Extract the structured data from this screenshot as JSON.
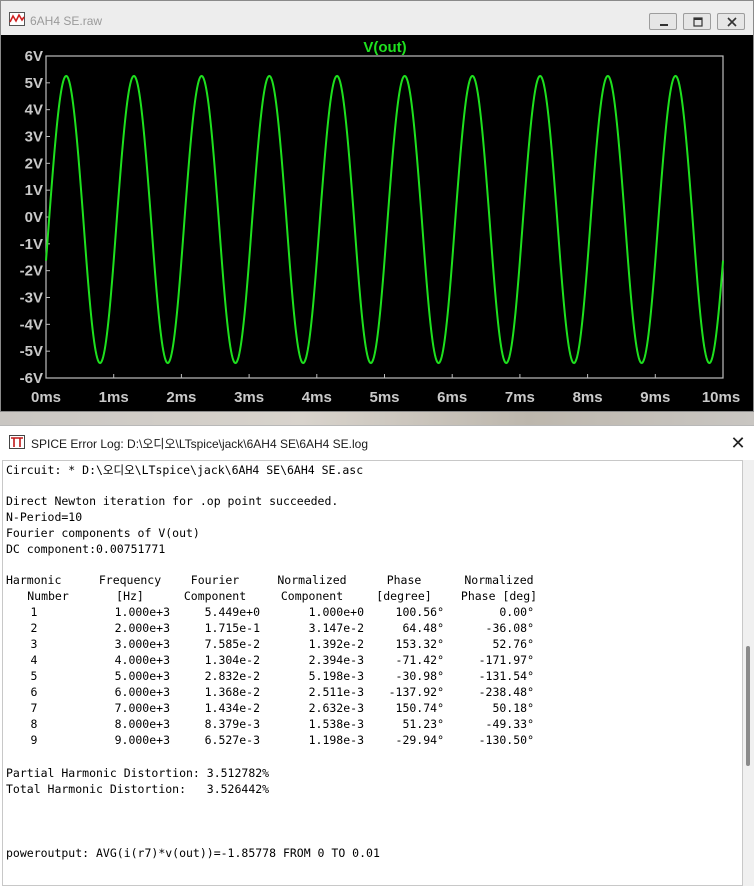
{
  "wave_window": {
    "title": "6AH4 SE.raw",
    "trace_name": "V(out)",
    "trace_color": "#1ee01e",
    "background_color": "#000000"
  },
  "chart_data": {
    "type": "line",
    "title": "V(out)",
    "xlabel": "",
    "ylabel": "",
    "x_tick_labels": [
      "0ms",
      "1ms",
      "2ms",
      "3ms",
      "4ms",
      "5ms",
      "6ms",
      "7ms",
      "8ms",
      "9ms",
      "10ms"
    ],
    "y_tick_labels": [
      "6V",
      "5V",
      "4V",
      "3V",
      "2V",
      "1V",
      "0V",
      "-1V",
      "-2V",
      "-3V",
      "-4V",
      "-5V",
      "-6V"
    ],
    "xlim": [
      0,
      10
    ],
    "ylim": [
      -6,
      6
    ],
    "grid": false,
    "series": [
      {
        "name": "V(out)",
        "frequency_hz": 1000,
        "amplitude": 5.449,
        "offset": 0.0075,
        "phase_deg": 100.56,
        "x": [
          0,
          0.25,
          0.5,
          0.75,
          1.0,
          1.25,
          1.5,
          1.75,
          2.0,
          2.25,
          2.5,
          2.75,
          3.0,
          3.25,
          3.5,
          3.75,
          4.0,
          4.25,
          4.5,
          4.75,
          5.0,
          5.25,
          5.5,
          5.75,
          6.0,
          6.25,
          6.5,
          6.75,
          7.0,
          7.25,
          7.5,
          7.75,
          8.0,
          8.25,
          8.5,
          8.75,
          9.0,
          9.25,
          9.5,
          9.75,
          10.0
        ],
        "y": [
          -1.0,
          5.2,
          1.0,
          -5.4,
          -1.0,
          5.2,
          1.0,
          -5.4,
          -1.0,
          5.2,
          1.0,
          -5.4,
          -1.0,
          5.2,
          1.0,
          -5.4,
          -1.0,
          5.2,
          1.0,
          -5.4,
          -1.0,
          5.2,
          1.0,
          -5.4,
          -1.0,
          5.2,
          1.0,
          -5.4,
          -1.0,
          5.2,
          1.0,
          -5.4,
          -1.0,
          5.2,
          1.0,
          -5.4,
          -1.0,
          5.2,
          1.0,
          -5.4,
          -1.0
        ]
      }
    ]
  },
  "log_window": {
    "title": "SPICE Error Log: D:\\오디오\\LTspice\\jack\\6AH4 SE\\6AH4 SE.log",
    "close_glyph": "✕",
    "lines": {
      "circuit": "Circuit: * D:\\오디오\\LTspice\\jack\\6AH4 SE\\6AH4 SE.asc",
      "newton": "Direct Newton iteration for .op point succeeded.",
      "nperiod": "N-Period=10",
      "fourier": "Fourier components of V(out)",
      "dc": "DC component:0.00751771",
      "partial": "Partial Harmonic Distortion: 3.512782%",
      "total": "Total Harmonic Distortion:   3.526442%",
      "power": "poweroutput: AVG(i(r7)*v(out))=-1.85778 FROM 0 TO 0.01"
    },
    "table": {
      "header1": [
        "Harmonic",
        "Frequency",
        "Fourier",
        "Normalized",
        "Phase",
        "Normalized"
      ],
      "header2": [
        "Number",
        "[Hz]",
        "Component",
        "Component",
        "[degree]",
        "Phase [deg]"
      ],
      "rows": [
        [
          "1",
          "1.000e+3",
          "5.449e+0",
          "1.000e+0",
          "100.56°",
          "0.00°"
        ],
        [
          "2",
          "2.000e+3",
          "1.715e-1",
          "3.147e-2",
          "64.48°",
          "-36.08°"
        ],
        [
          "3",
          "3.000e+3",
          "7.585e-2",
          "1.392e-2",
          "153.32°",
          "52.76°"
        ],
        [
          "4",
          "4.000e+3",
          "1.304e-2",
          "2.394e-3",
          "-71.42°",
          "-171.97°"
        ],
        [
          "5",
          "5.000e+3",
          "2.832e-2",
          "5.198e-3",
          "-30.98°",
          "-131.54°"
        ],
        [
          "6",
          "6.000e+3",
          "1.368e-2",
          "2.511e-3",
          "-137.92°",
          "-238.48°"
        ],
        [
          "7",
          "7.000e+3",
          "1.434e-2",
          "2.632e-3",
          "150.74°",
          "50.18°"
        ],
        [
          "8",
          "8.000e+3",
          "8.379e-3",
          "1.538e-3",
          "51.23°",
          "-49.33°"
        ],
        [
          "9",
          "9.000e+3",
          "6.527e-3",
          "1.198e-3",
          "-29.94°",
          "-130.50°"
        ]
      ]
    }
  }
}
